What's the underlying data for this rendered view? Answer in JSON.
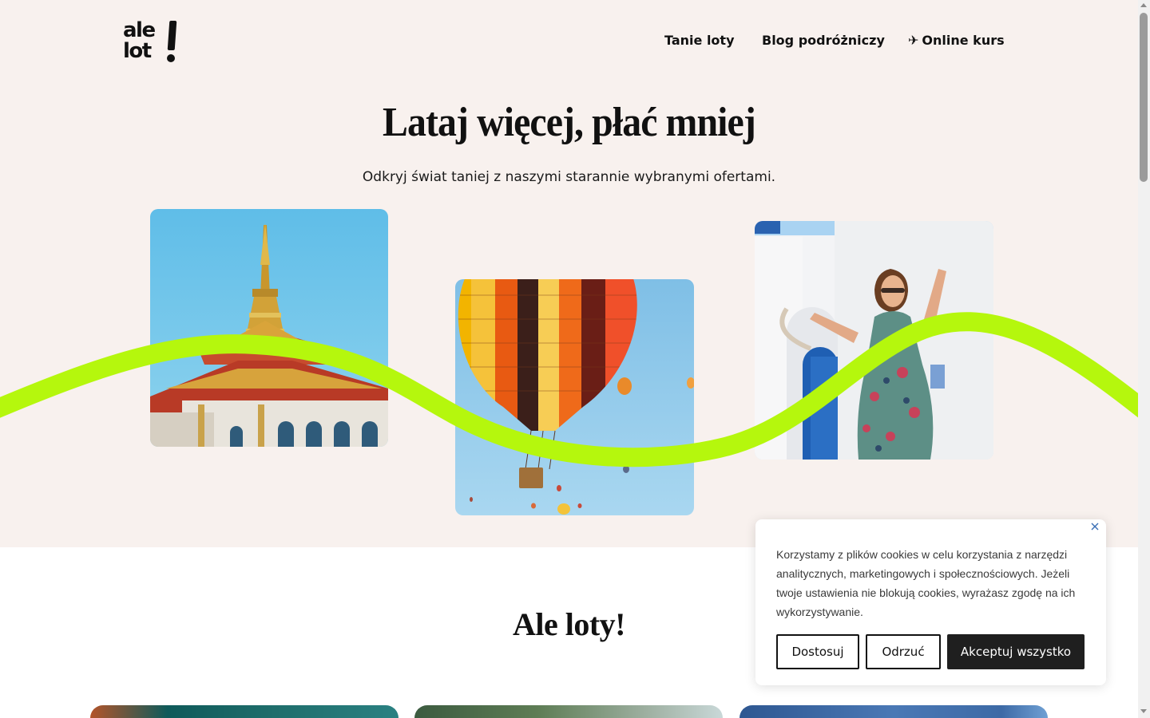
{
  "header": {
    "logo_line1": "ale",
    "logo_line2": "lot",
    "nav": [
      {
        "label": "Tanie loty"
      },
      {
        "label": "Blog podróżniczy"
      },
      {
        "label": "Online kurs",
        "icon": "airplane-icon",
        "glyph": "✈"
      }
    ]
  },
  "hero": {
    "title": "Lataj więcej, płać mniej",
    "subtitle": "Odkryj świat taniej z naszymi starannie wybranymi ofertami.",
    "accent_color": "#b5f70d",
    "background": "#f8f1ee"
  },
  "section": {
    "title": "Ale loty!"
  },
  "cookie_banner": {
    "text": "Korzystamy z plików cookies w celu korzystania z narzędzi analitycznych, marketingowych i społecznościowych. Jeżeli twoje ustawienia nie blokują cookies, wyrażasz zgodę na ich wykorzystywanie.",
    "buttons": {
      "customize": "Dostosuj",
      "reject": "Odrzuć",
      "accept": "Akceptuj wszystko"
    },
    "close_icon": "close-icon"
  }
}
